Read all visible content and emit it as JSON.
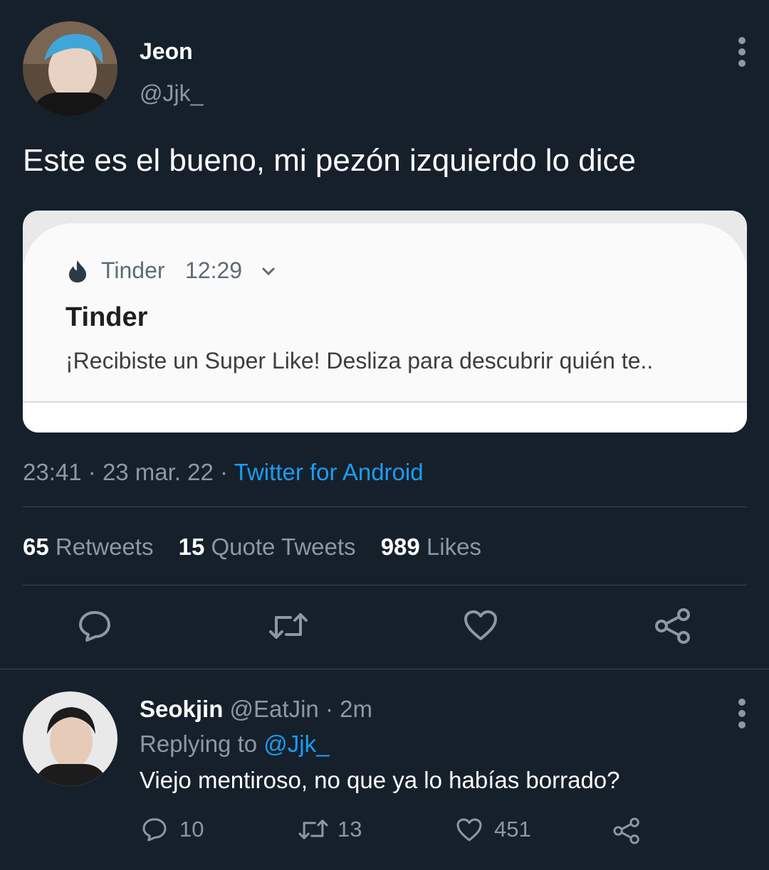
{
  "tweet": {
    "display_name": "Jeon",
    "handle": "@Jjk_",
    "text": "Este es el bueno, mi pezón izquierdo lo dice",
    "notification": {
      "app_name": "Tinder",
      "time": "12:29",
      "title": "Tinder",
      "body": "¡Recibiste un Super Like! Desliza para descubrir quién te.."
    },
    "time": "23:41",
    "sep1": "·",
    "date": "23 mar. 22",
    "sep2": "·",
    "source": "Twitter for Android",
    "stats": {
      "retweets_count": "65",
      "retweets_label": "Retweets",
      "quotes_count": "15",
      "quotes_label": "Quote Tweets",
      "likes_count": "989",
      "likes_label": "Likes"
    },
    "actions": [
      "reply-icon",
      "retweet-icon",
      "like-icon",
      "share-icon"
    ]
  },
  "reply": {
    "display_name": "Seokjin",
    "handle": "@EatJin",
    "sep": "·",
    "time": "2m",
    "replying_prefix": "Replying to",
    "replying_to": "@Jjk_",
    "text": "Viejo mentiroso, no que ya lo habías borrado?",
    "reply_count": "10",
    "retweet_count": "13",
    "like_count": "451"
  },
  "colors": {
    "background": "#15202b",
    "text": "#ffffff",
    "muted": "#8b98a5",
    "link": "#1d9bf0",
    "divider": "#38444d"
  }
}
